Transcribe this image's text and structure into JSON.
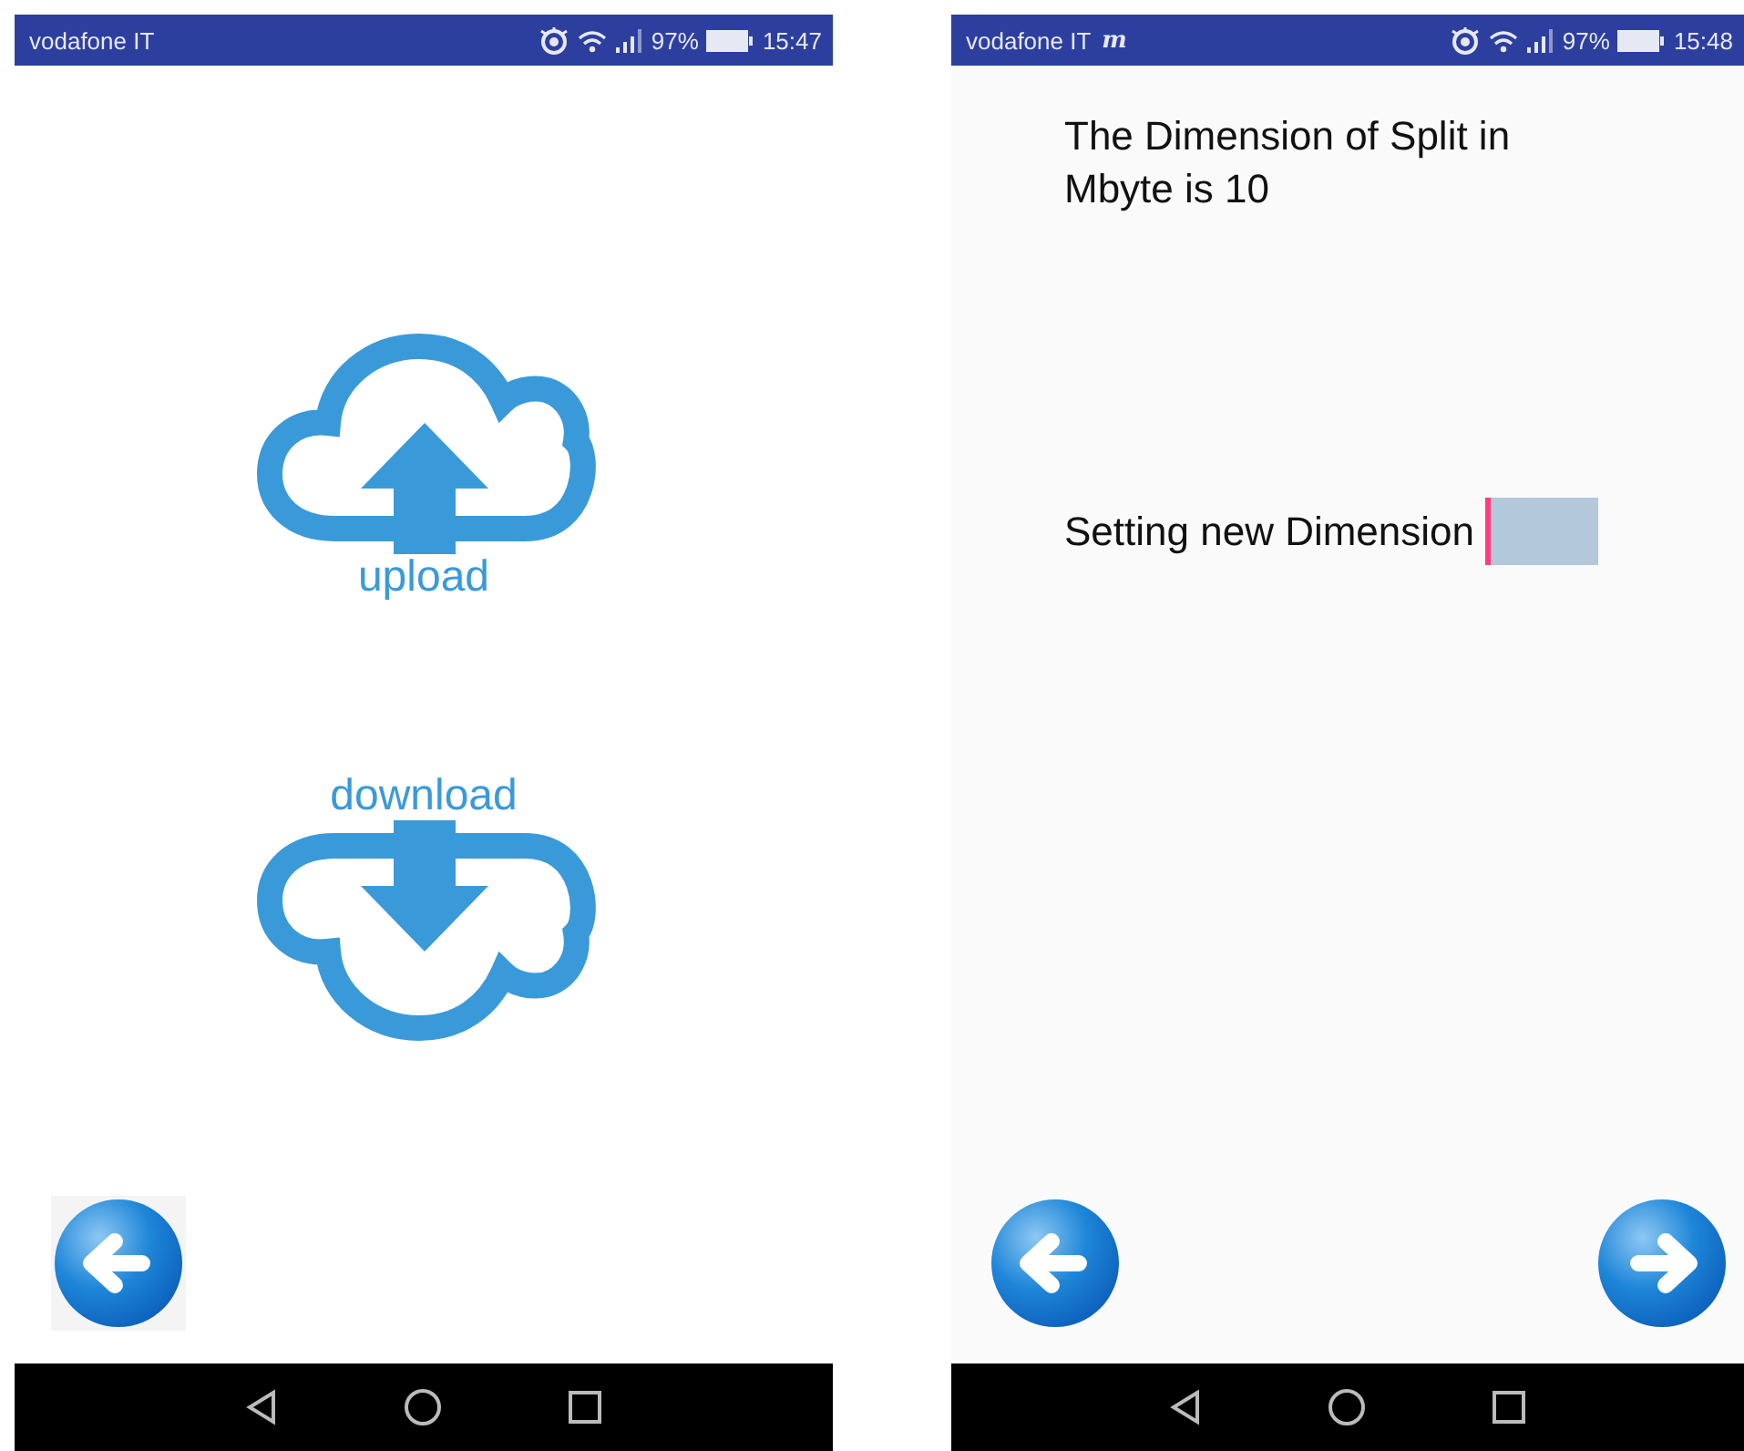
{
  "screens": [
    {
      "kind": "menu",
      "status_bar": {
        "carrier": "vodafone IT",
        "battery": "97%",
        "time": "15:47"
      },
      "actions": [
        {
          "kind": "upload",
          "label": "upload"
        },
        {
          "kind": "download",
          "label": "download"
        }
      ],
      "nav_buttons": [
        {
          "kind": "back"
        }
      ]
    },
    {
      "kind": "settings",
      "status_bar": {
        "carrier": "vodafone IT",
        "carrier_badge": "m",
        "battery": "97%",
        "time": "15:48"
      },
      "message": "The Dimension of Split in Mbyte is 10",
      "field": {
        "label": "Setting new Dimension",
        "focused": true
      },
      "nav_buttons": [
        {
          "kind": "back"
        },
        {
          "kind": "forward"
        }
      ]
    }
  ]
}
